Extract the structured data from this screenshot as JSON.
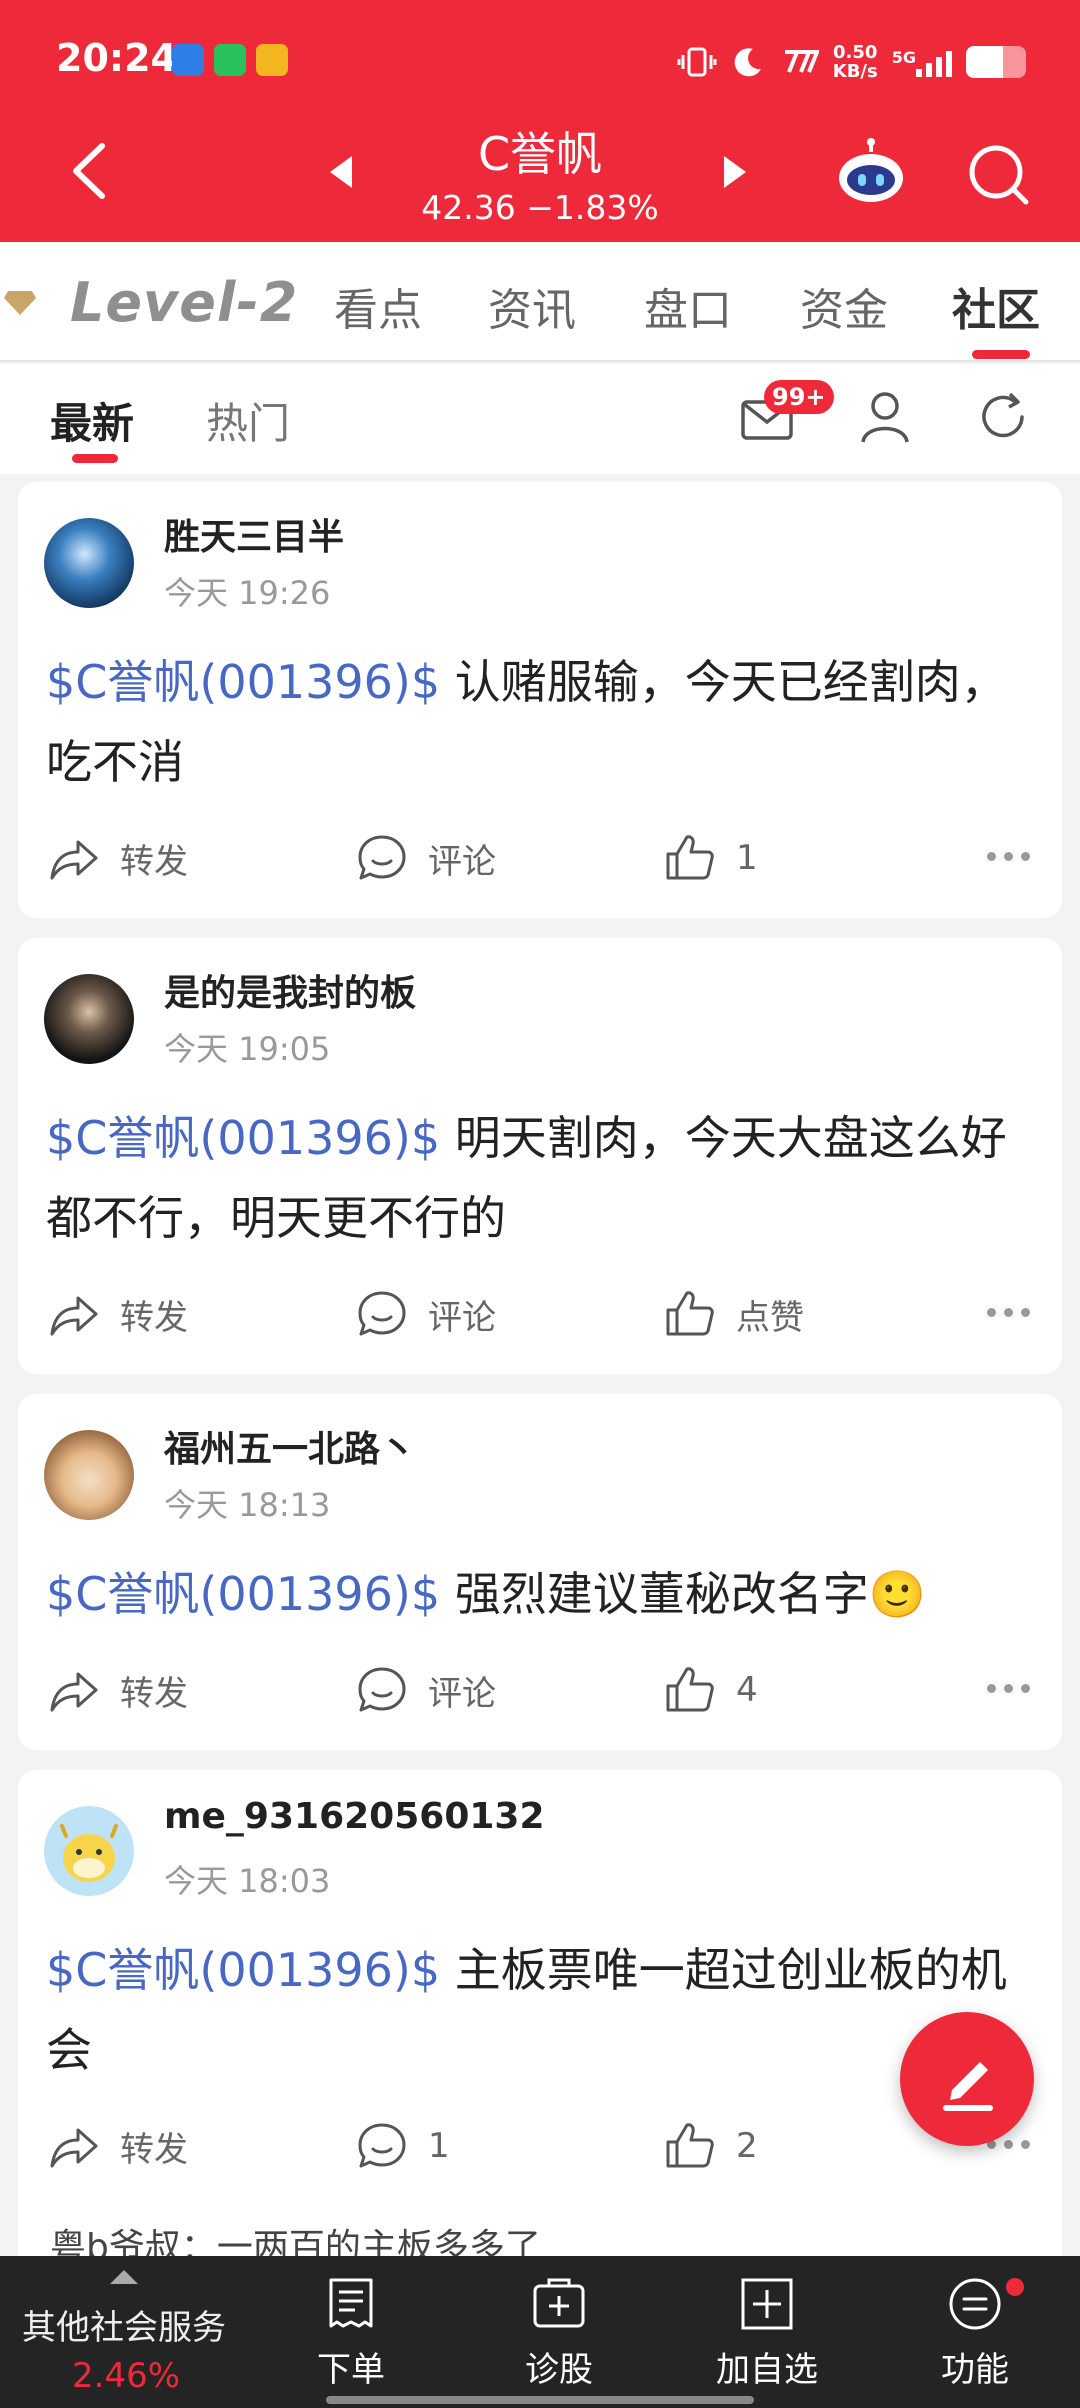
{
  "status_bar": {
    "time": "20:24",
    "net_speed_value": "0.50",
    "net_speed_unit": "KB/s",
    "network": "5G",
    "battery_level": 0.62
  },
  "header": {
    "title": "C誉帆",
    "quote": "42.36  −1.83%"
  },
  "top_tabs": {
    "level2": "Level-2",
    "items": [
      "看点",
      "资讯",
      "盘口",
      "资金",
      "社区"
    ],
    "active": "社区"
  },
  "sub_tabs": {
    "items": [
      "最新",
      "热门"
    ],
    "active": "最新",
    "message_badge": "99+"
  },
  "posts": [
    {
      "user": "胜天三目半",
      "time": "今天 19:26",
      "tag": "$C誉帆(001396)$",
      "text": " 认赌服输，今天已经割肉，吃不消",
      "forward": "转发",
      "comment": "评论",
      "like": "1"
    },
    {
      "user": "是的是我封的板",
      "time": "今天 19:05",
      "tag": "$C誉帆(001396)$",
      "text": " 明天割肉，今天大盘这么好都不行，明天更不行的",
      "forward": "转发",
      "comment": "评论",
      "like": "点赞"
    },
    {
      "user": "福州五一北路丶",
      "time": "今天 18:13",
      "tag": "$C誉帆(001396)$",
      "text": " 强烈建议董秘改名字🙂",
      "forward": "转发",
      "comment": "评论",
      "like": "4"
    },
    {
      "user": "me_931620560132",
      "time": "今天 18:03",
      "tag": "$C誉帆(001396)$",
      "text": " 主板票唯一超过创业板的机会",
      "forward": "转发",
      "comment": "1",
      "like": "2"
    }
  ],
  "reply_preview": "粤b爷叔：一两百的主板多多了",
  "bottom_bar": {
    "left_label": "其他社会服务",
    "left_pct": "2.46%",
    "items": [
      "下单",
      "诊股",
      "加自选",
      "功能"
    ]
  }
}
